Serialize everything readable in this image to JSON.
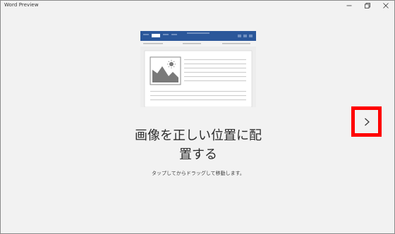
{
  "window": {
    "title": "Word Preview",
    "controls": [
      "minimize",
      "maximize",
      "close"
    ]
  },
  "main": {
    "headline_line1": "画像を正しい位置に配",
    "headline_line2": "置する",
    "subtitle": "タップしてからドラッグして移動します。"
  },
  "navigation": {
    "next_icon": "chevron-right-icon"
  },
  "colors": {
    "ribbon_blue": "#2b579a",
    "highlight_red": "#ff0000",
    "background": "#f2f2f2"
  }
}
